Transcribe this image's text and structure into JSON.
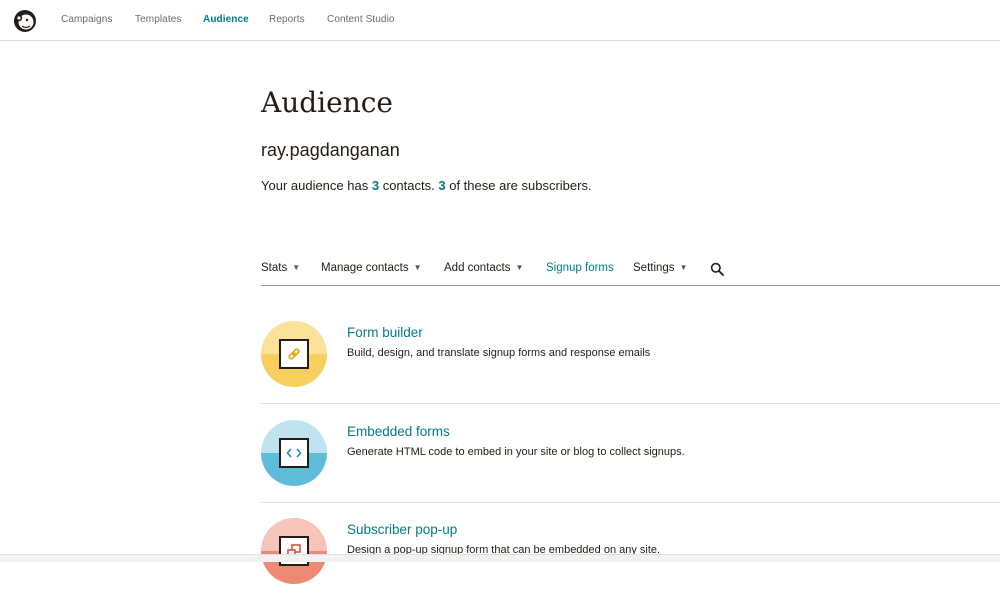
{
  "topnav": {
    "items": [
      {
        "label": "Campaigns",
        "active": false
      },
      {
        "label": "Templates",
        "active": false
      },
      {
        "label": "Audience",
        "active": true
      },
      {
        "label": "Reports",
        "active": false
      },
      {
        "label": "Content Studio",
        "active": false
      }
    ]
  },
  "header": {
    "title": "Audience",
    "account": "ray.pagdanganan",
    "summary": {
      "prefix": "Your audience has",
      "contacts_count": "3",
      "middle": "contacts.",
      "subscribers_count": "3",
      "suffix": "of these are subscribers."
    }
  },
  "subnav": {
    "items": [
      {
        "label": "Stats",
        "dropdown": true,
        "active": false
      },
      {
        "label": "Manage contacts",
        "dropdown": true,
        "active": false
      },
      {
        "label": "Add contacts",
        "dropdown": true,
        "active": false
      },
      {
        "label": "Signup forms",
        "dropdown": false,
        "active": true
      },
      {
        "label": "Settings",
        "dropdown": true,
        "active": false
      }
    ],
    "search_icon": "search-icon"
  },
  "features": [
    {
      "title": "Form builder",
      "description": "Build, design, and translate signup forms and response emails",
      "icon": "link-icon",
      "color": "#fbe29a",
      "color_dark": "#f6cf5e"
    },
    {
      "title": "Embedded forms",
      "description": "Generate HTML code to embed in your site or blog to collect signups.",
      "icon": "code-icon",
      "color": "#bfe4f0",
      "color_dark": "#5fbcd9"
    },
    {
      "title": "Subscriber pop-up",
      "description": "Design a pop-up signup form that can be embedded on any site.",
      "icon": "popup-icon",
      "color": "#f6c4b8",
      "color_dark": "#ee8a74"
    }
  ],
  "colors": {
    "accent": "#007c89",
    "text": "#241c15"
  }
}
